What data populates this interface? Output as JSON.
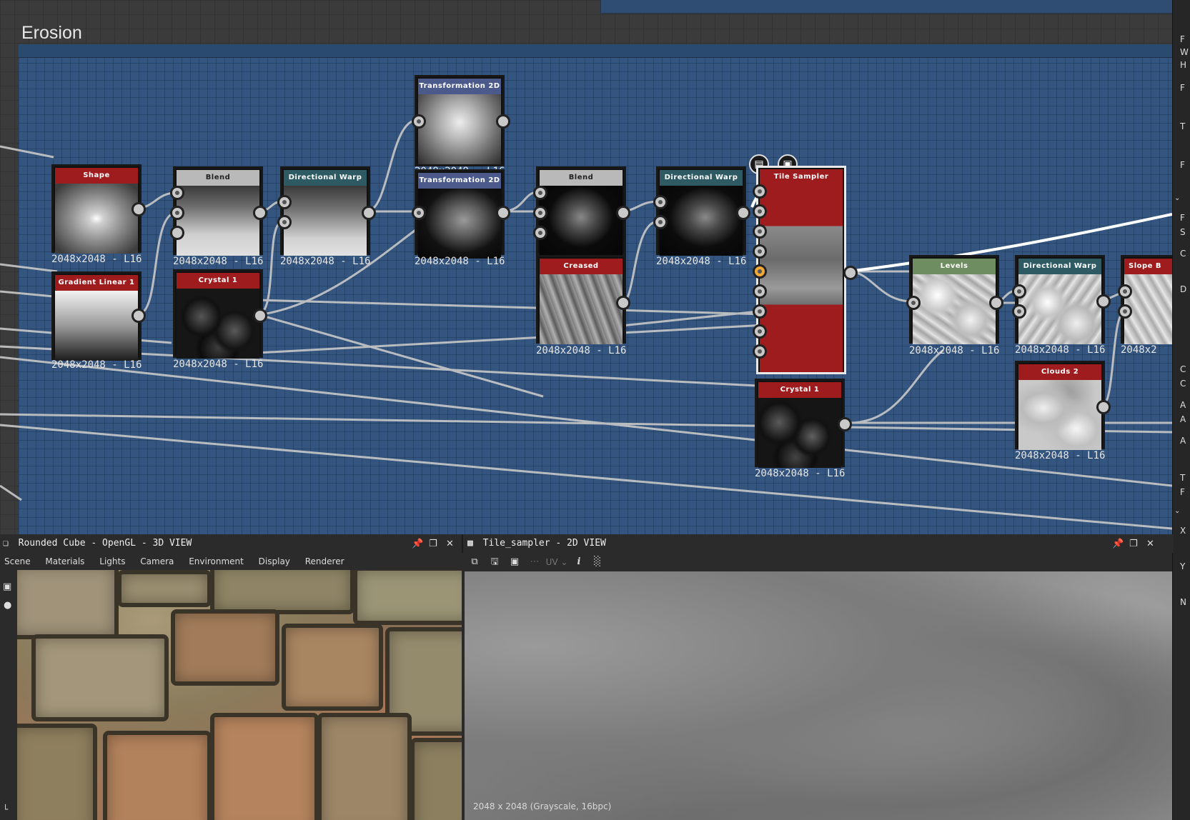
{
  "graph": {
    "frame_title": "Erosion",
    "nodes": [
      {
        "title": "Shape",
        "size": "2048x2048 - L16"
      },
      {
        "title": "Blend",
        "size": "2048x2048 - L16"
      },
      {
        "title": "Directional Warp",
        "size": "2048x2048 - L16"
      },
      {
        "title": "Transformation 2D",
        "size": "2048x2048 - L16"
      },
      {
        "title": "Transformation 2D",
        "size": "2048x2048 - L16"
      },
      {
        "title": "Blend",
        "size": ""
      },
      {
        "title": "Directional Warp",
        "size": "2048x2048 - L16"
      },
      {
        "title": "Tile Sampler",
        "size": ""
      },
      {
        "title": "Gradient Linear 1",
        "size": "2048x2048 - L16"
      },
      {
        "title": "Crystal 1",
        "size": "2048x2048 - L16"
      },
      {
        "title": "Creased",
        "size": "2048x2048 - L16"
      },
      {
        "title": "Crystal 1",
        "size": "2048x2048 - L16"
      },
      {
        "title": "Levels",
        "size": "2048x2048 - L16"
      },
      {
        "title": "Directional Warp",
        "size": "2048x2048 - L16"
      },
      {
        "title": "Slope B",
        "size": "2048x2"
      },
      {
        "title": "Clouds 2",
        "size": "2048x2048 - L16"
      }
    ]
  },
  "view3d": {
    "title": "Rounded Cube - OpenGL - 3D VIEW",
    "menu": [
      "Scene",
      "Materials",
      "Lights",
      "Camera",
      "Environment",
      "Display",
      "Renderer"
    ]
  },
  "view2d": {
    "title": "Tile_sampler - 2D VIEW",
    "uv_label": "UV",
    "status": "2048 x 2048 (Grayscale, 16bpc)"
  },
  "right_panel": {
    "letters": [
      "F",
      "W",
      "H",
      "F",
      "T",
      "F",
      "F",
      "S",
      "C",
      "D",
      "C",
      "C",
      "A",
      "A",
      "A",
      "T",
      "F",
      "X",
      "Y",
      "N"
    ]
  },
  "colors": {
    "frame_blue": "#33557f",
    "node_red": "#9e1b1e",
    "node_teal": "#2d5a63",
    "node_green": "#6e8e62",
    "port_selected": "#f0a83a"
  }
}
